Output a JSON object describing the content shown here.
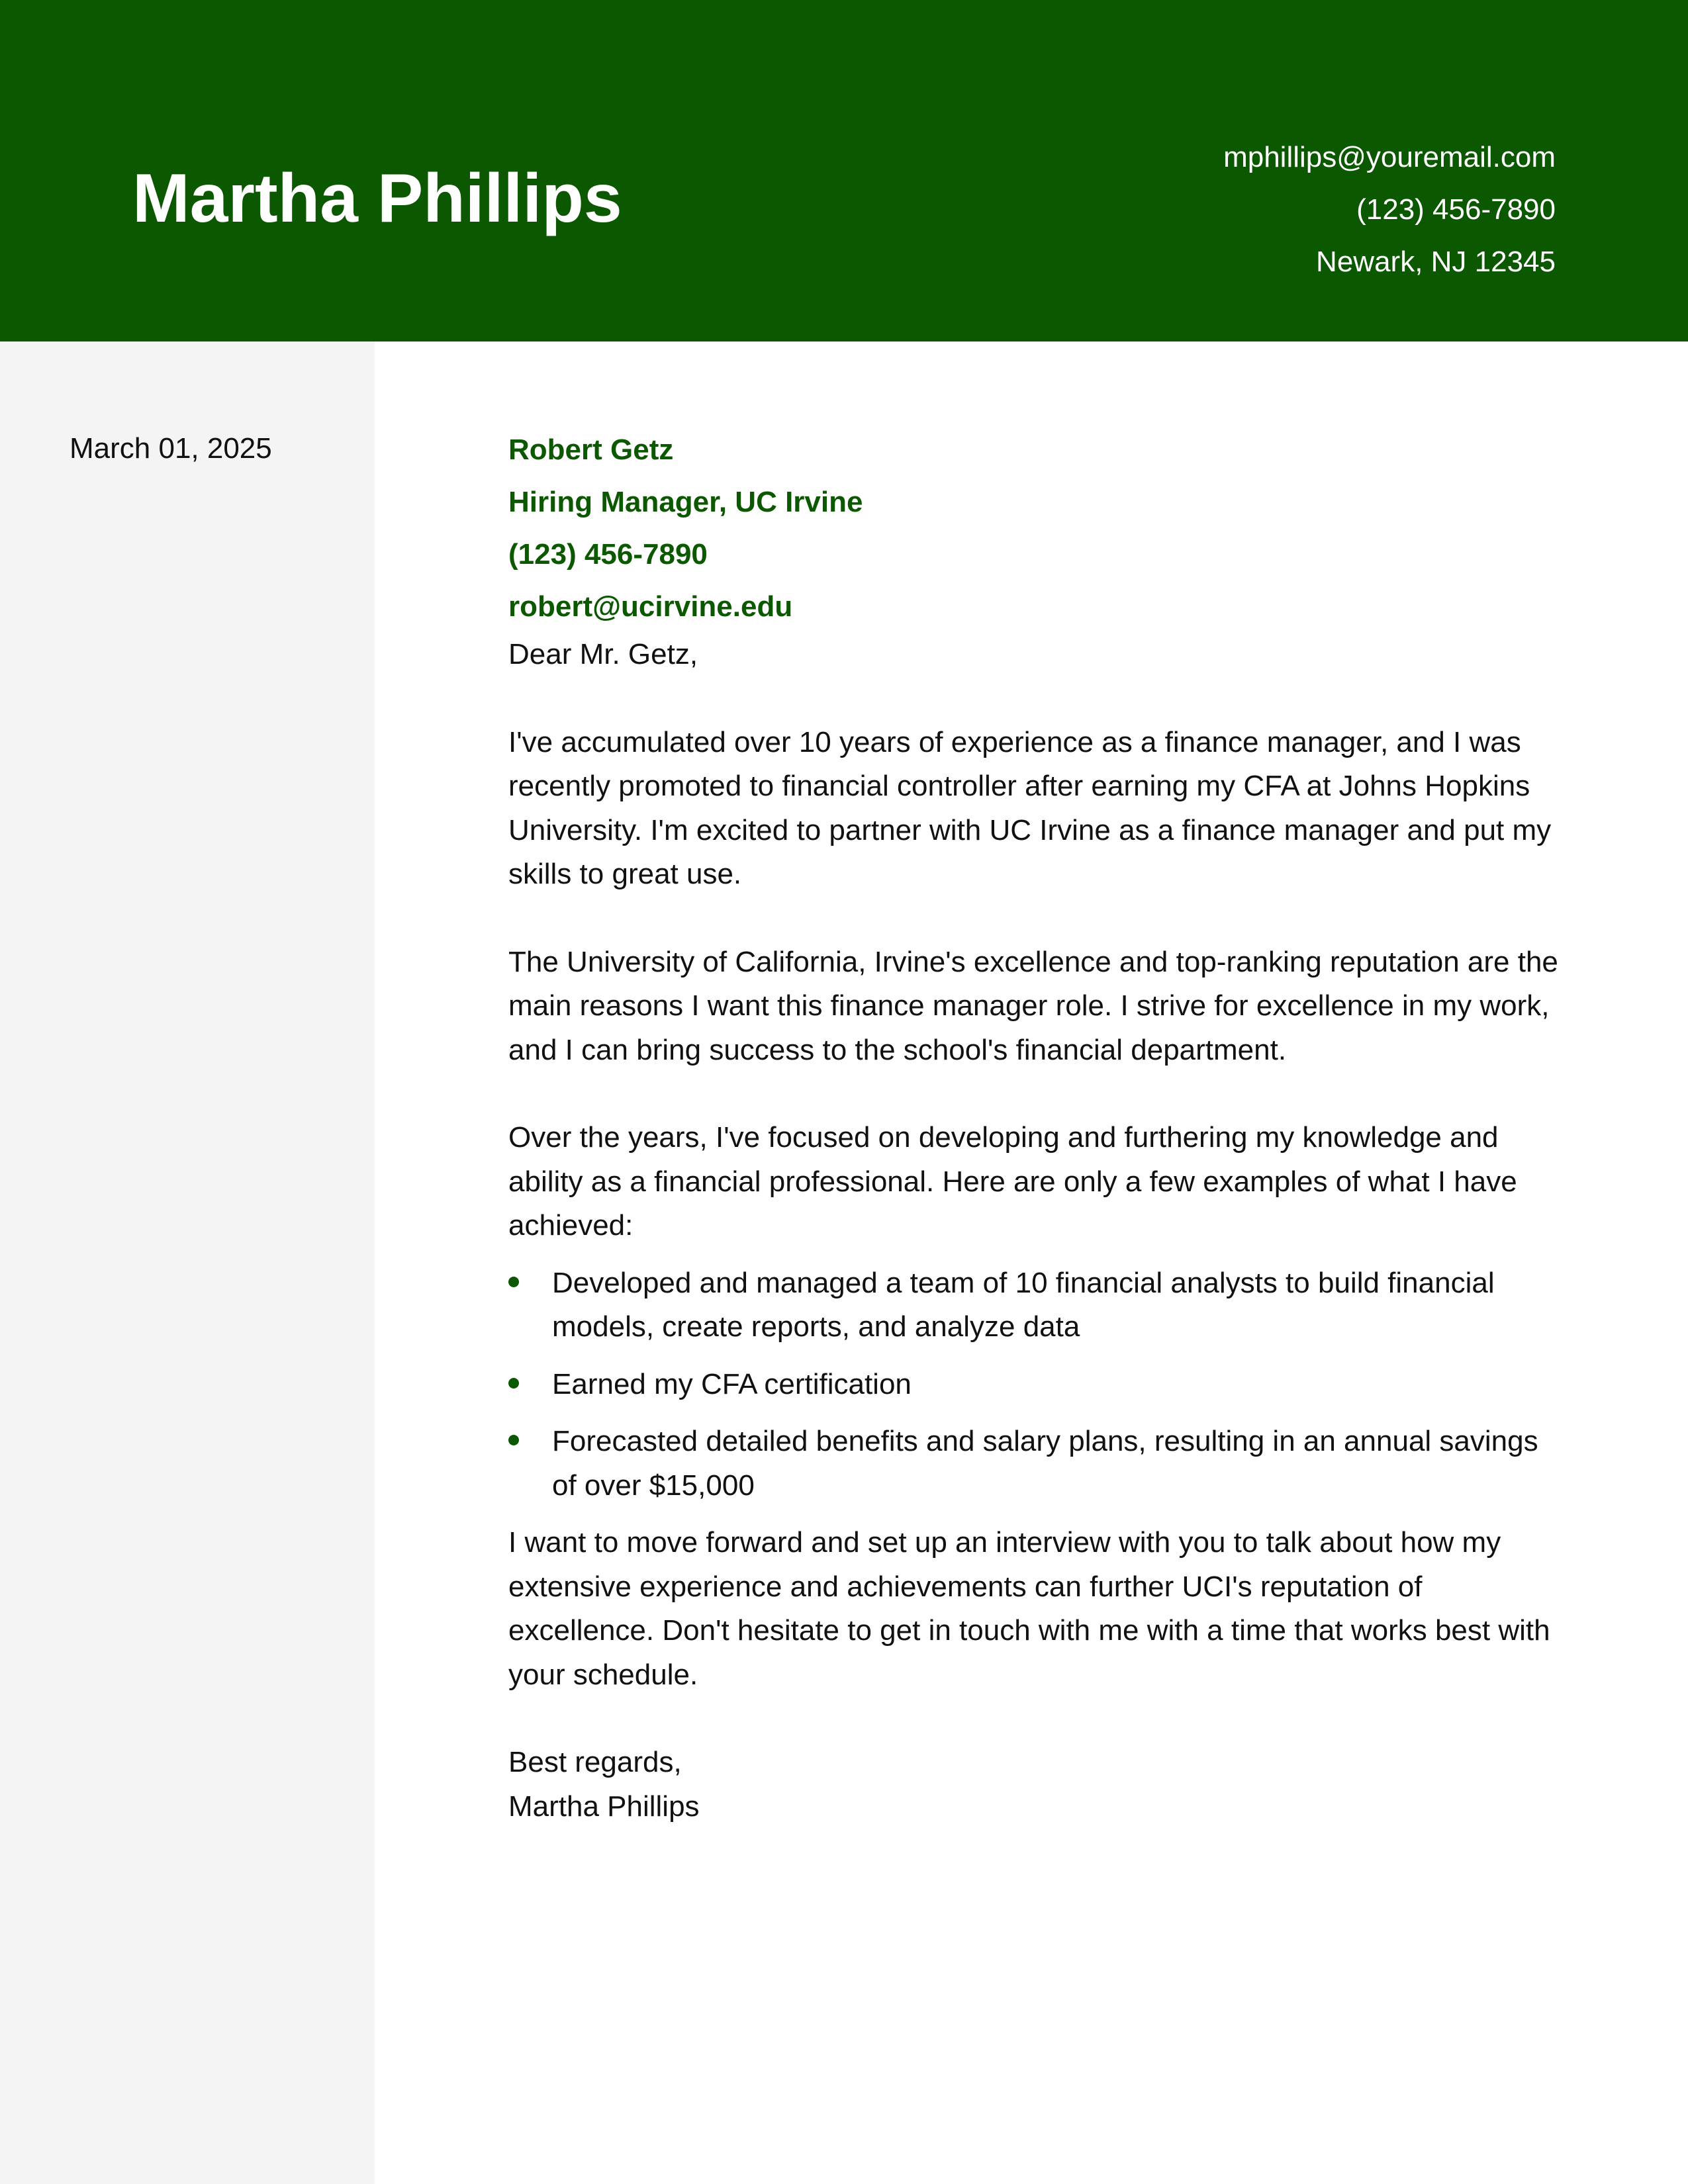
{
  "header": {
    "name": "Martha Phillips",
    "email": "mphillips@youremail.com",
    "phone": "(123) 456-7890",
    "location": "Newark, NJ 12345"
  },
  "sidebar": {
    "date": "March 01, 2025"
  },
  "recipient": {
    "name": "Robert Getz",
    "title": "Hiring Manager, UC Irvine",
    "phone": "(123) 456-7890",
    "email": "robert@ucirvine.edu"
  },
  "letter": {
    "salutation": "Dear Mr. Getz,",
    "paragraphs": [
      "I've accumulated over 10 years of experience as a finance manager, and I was recently promoted to financial controller after earning my CFA at Johns Hopkins University. I'm excited to partner with UC Irvine as a finance manager and put my skills to great use.",
      "The University of California, Irvine's excellence and top-ranking reputation are the main reasons I want this finance manager role. I strive for excellence in my work, and I can bring success to the school's financial department.",
      "Over the years, I've focused on developing and furthering my knowledge and ability as a financial professional. Here are only a few examples of what I have achieved:"
    ],
    "achievements": [
      "Developed and managed a team of 10 financial analysts to build financial models, create reports, and analyze data",
      "Earned my CFA certification",
      "Forecasted detailed benefits and salary plans, resulting in an annual savings of over $15,000"
    ],
    "closing_paragraph": "I want to move forward and set up an interview with you to talk about how my extensive experience and achievements can further UCI's reputation of excellence. Don't hesitate to get in touch with me with a time that works best with your schedule.",
    "signoff": "Best regards,",
    "signature": "Martha Phillips"
  },
  "colors": {
    "accent": "#0b5801",
    "sidebar_bg": "#f4f4f4",
    "text": "#111111"
  }
}
